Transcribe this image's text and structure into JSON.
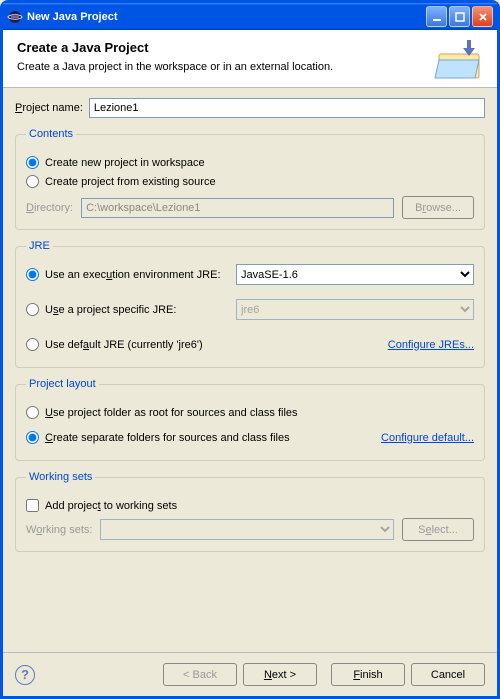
{
  "window": {
    "title": "New Java Project"
  },
  "banner": {
    "title": "Create a Java Project",
    "subtitle": "Create a Java project in the workspace or in an external location."
  },
  "projectName": {
    "label": "Project name:",
    "value": "Lezione1"
  },
  "contents": {
    "legend": "Contents",
    "opt1": "Create new project in workspace",
    "opt2": "Create project from existing source",
    "dirLabel": "Directory:",
    "dirValue": "C:\\workspace\\Lezione1",
    "browse": "Browse..."
  },
  "jre": {
    "legend": "JRE",
    "opt1": "Use an execution environment JRE:",
    "opt2": "Use a project specific JRE:",
    "opt3": "Use default JRE (currently 'jre6')",
    "envValue": "JavaSE-1.6",
    "specValue": "jre6",
    "configure": "Configure JREs..."
  },
  "layout": {
    "legend": "Project layout",
    "opt1": "Use project folder as root for sources and class files",
    "opt2": "Create separate folders for sources and class files",
    "configure": "Configure default..."
  },
  "ws": {
    "legend": "Working sets",
    "check": "Add project to working sets",
    "label": "Working sets:",
    "select": "Select..."
  },
  "buttons": {
    "back": "< Back",
    "next": "Next >",
    "finish": "Finish",
    "cancel": "Cancel"
  }
}
